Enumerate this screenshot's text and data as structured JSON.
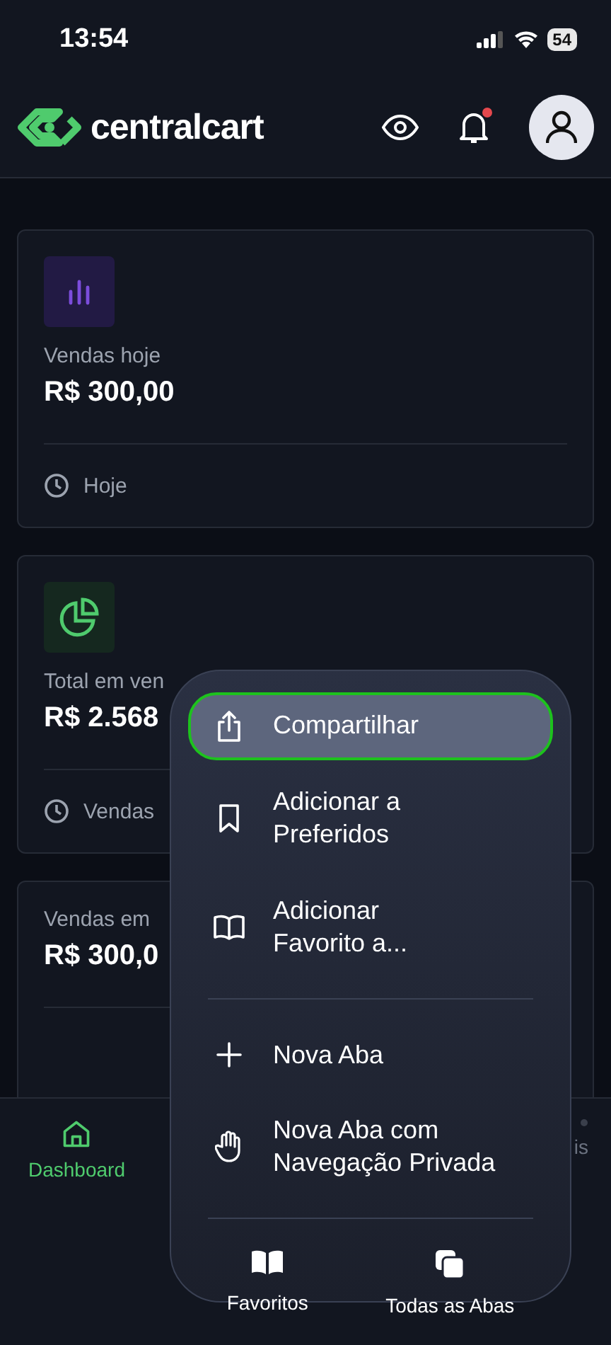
{
  "status_bar": {
    "time": "13:54",
    "battery": "54"
  },
  "header": {
    "logo_text": "centralcart",
    "notification_unread": true
  },
  "cards": [
    {
      "kind": "bars",
      "label": "Vendas hoje",
      "value": "R$ 300,00",
      "footer": "Hoje"
    },
    {
      "kind": "pie",
      "label": "Total em ven",
      "value": "R$ 2.568",
      "footer": "Vendas"
    },
    {
      "kind": "plain",
      "label": "Vendas em",
      "value": "R$ 300,0"
    }
  ],
  "bottom_nav": [
    {
      "kind": "home",
      "label": "Dashboard",
      "selected": true
    },
    {
      "kind": "more",
      "label": "is",
      "selected": false
    }
  ],
  "context_menu": {
    "sections": [
      [
        {
          "kind": "share",
          "lines": [
            "Compartilhar"
          ],
          "selected": true
        },
        {
          "kind": "bookmark",
          "lines": [
            "Adicionar a",
            "Preferidos"
          ],
          "selected": false
        },
        {
          "kind": "book",
          "lines": [
            "Adicionar",
            "Favorito a..."
          ],
          "selected": false
        }
      ],
      [
        {
          "kind": "plus",
          "lines": [
            "Nova Aba"
          ],
          "selected": false
        },
        {
          "kind": "hand",
          "lines": [
            "Nova Aba com",
            "Navegação Privada"
          ],
          "selected": false
        }
      ]
    ],
    "actions": [
      {
        "kind": "book-filled",
        "label": "Favoritos"
      },
      {
        "kind": "tabs",
        "label": "Todas as Abas"
      }
    ]
  }
}
